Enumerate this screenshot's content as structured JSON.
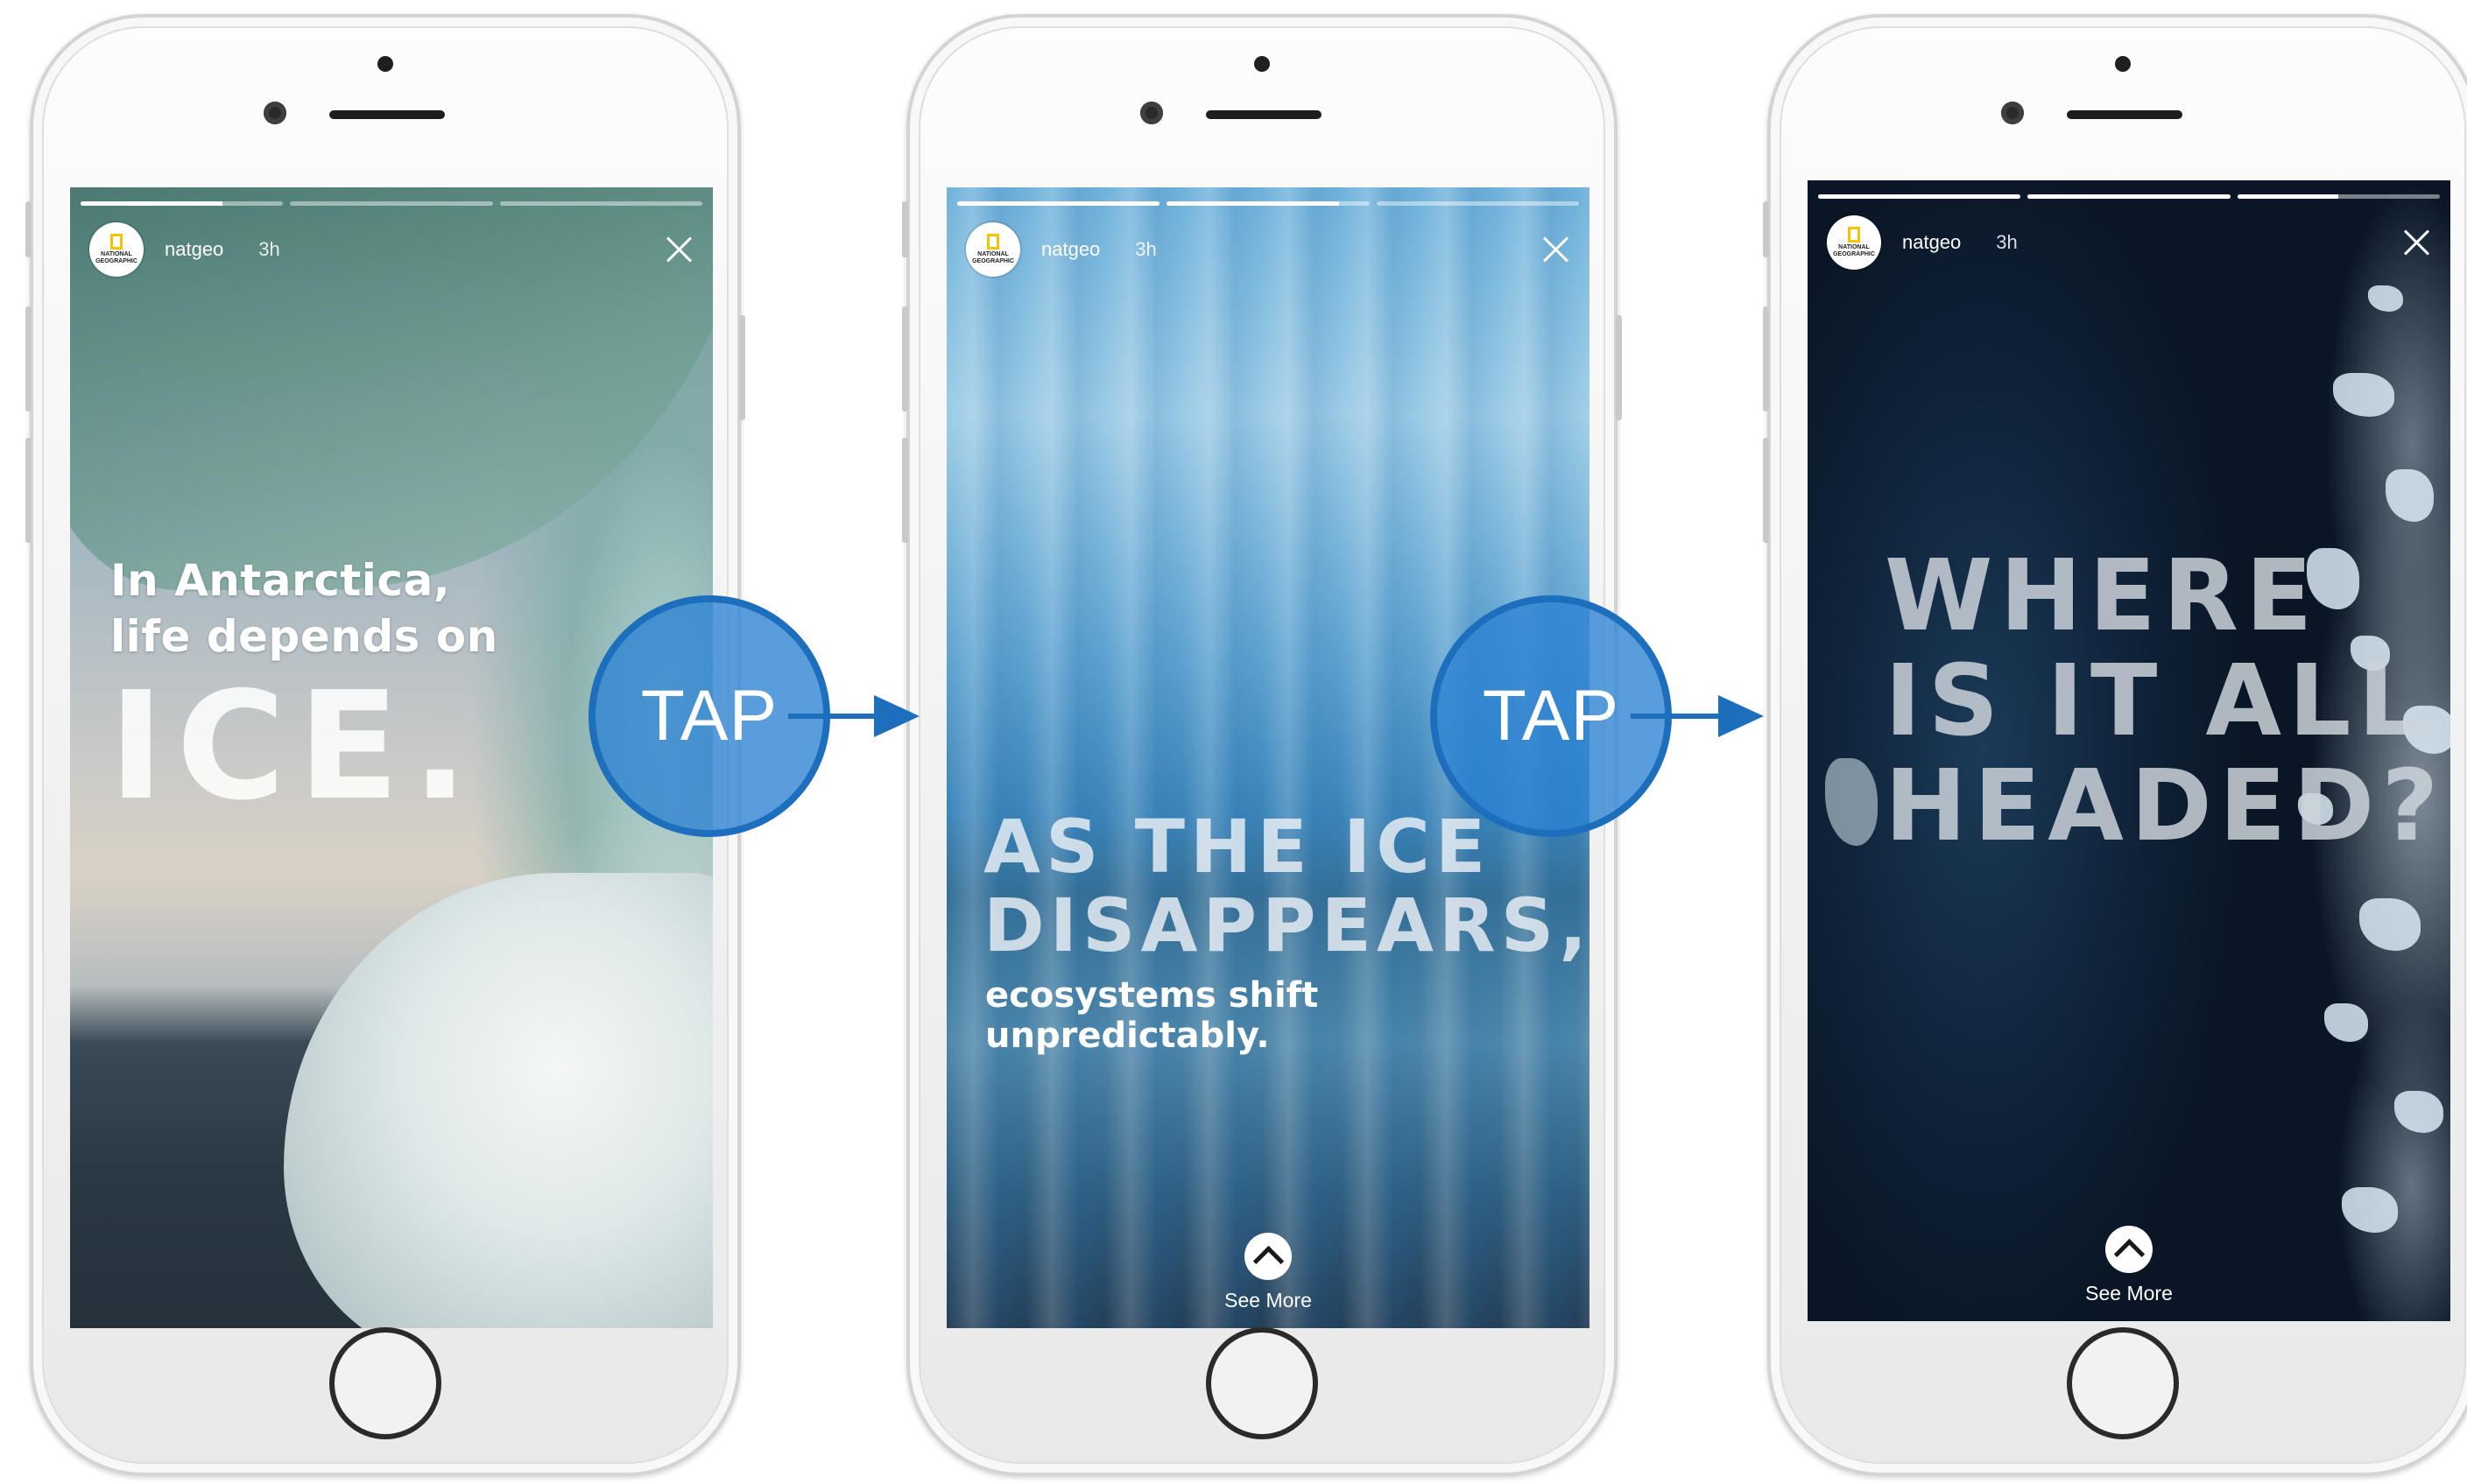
{
  "phones": [
    {
      "username": "natgeo",
      "time": "3h",
      "avatar_text": "NATIONAL GEOGRAPHIC",
      "progress": [
        0.7,
        0,
        0
      ],
      "lines": [
        "In Antarctica,",
        "life depends on"
      ],
      "big": "ICE."
    },
    {
      "username": "natgeo",
      "time": "3h",
      "avatar_text": "NATIONAL GEOGRAPHIC",
      "progress": [
        1,
        0.85,
        0
      ],
      "big_lines": [
        "AS THE ICE",
        "DISAPPEARS,"
      ],
      "small": "ecosystems shift unpredictably.",
      "see_more": "See More"
    },
    {
      "username": "natgeo",
      "time": "3h",
      "avatar_text": "NATIONAL GEOGRAPHIC",
      "progress": [
        1,
        1,
        0.5
      ],
      "big_lines": [
        "WHERE",
        "IS IT ALL",
        "HEADED?"
      ],
      "see_more": "See More"
    }
  ],
  "taps": [
    {
      "label": "TAP"
    },
    {
      "label": "TAP"
    }
  ],
  "colors": {
    "tap_fill": "#2c82d2",
    "tap_border": "#1d6fbe",
    "natgeo_yellow": "#f6c300"
  }
}
